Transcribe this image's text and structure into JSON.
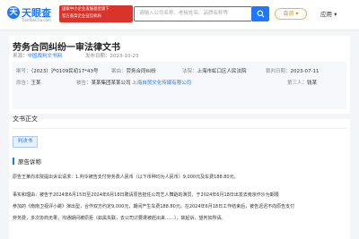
{
  "header": {
    "logo_mark": "天",
    "logo": "天眼查",
    "logo_sub": "TianYanCha.com",
    "banner_line1": "国家中小企业发展基金旗下",
    "banner_line2": "官方备案企业征信机构",
    "search_placeholder": "请输入公司名称、老板姓名、品牌名称等",
    "vip": "会员",
    "app": "应用"
  },
  "document": {
    "title": "劳务合同纠纷一审法律文书",
    "source_label": "来源：",
    "source": "中国裁判文书网",
    "date_label": "发布日期：",
    "date": "2023-10-23",
    "case_no_label": "案号：",
    "case_no": "（2023）沪0109民初17*43号",
    "cause_label": "案由：",
    "cause": "劳务合同纠纷",
    "court_label": "法院：",
    "court": "上海市虹口区人民法院",
    "judge_date_label": "裁判日期：",
    "judge_date": "2023-07-11",
    "plaintiff_label": "原告：",
    "plaintiff": "王某",
    "defendant_label": "被告：",
    "defendant": "某某集团某某公司",
    "defendant2": "上海自贸文化传媒有限公司",
    "third_label": "第三人：",
    "third": "钱某"
  },
  "section": {
    "title": "文书正文",
    "tag": "判决书",
    "sub_title": "原告诉称",
    "para1": "原告王某向本院提出诉讼请求：1.判令被告支付劳务费人民币（以下币种均为人民币）9,000元及车费188.80元。",
    "para2_a": "事实和理由：被告于2024年6月15日至2024年6月18日聘请原告担任公司艺人舞蹈的演员，于2024年6月18日出发去南京作沙为期限",
    "para2_b": "参加的《南南卫视评小跳》演出型，合作双方约定9,000元，期间产生车费188.80元。在2024年6月18日工作结束后，被告迟迟不向原告支付",
    "para2_c": "劳务费，多次协商无果，沟通期间被原拒（如黑失联，去公司讨要遭被赶出来……），故起诉，望判如所请。"
  }
}
